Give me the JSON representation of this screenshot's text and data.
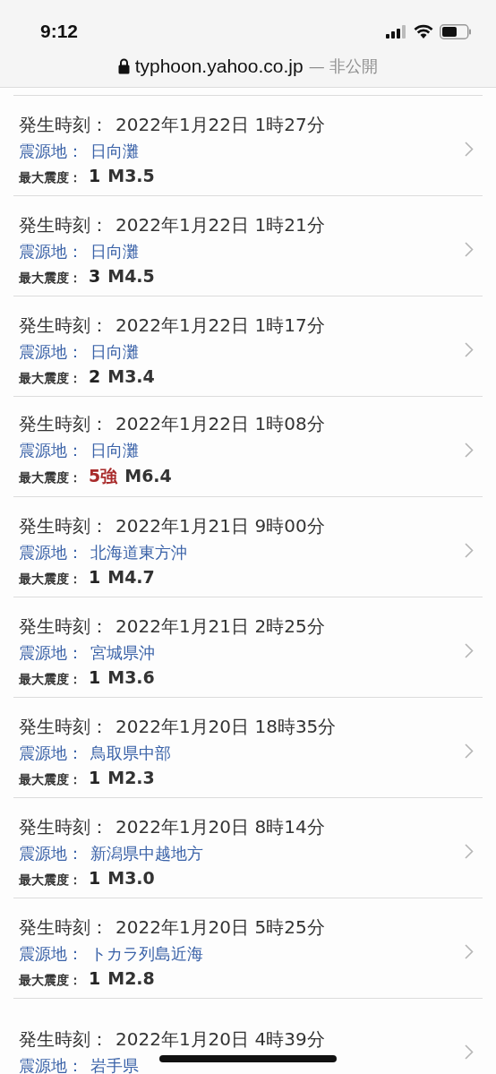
{
  "status_bar": {
    "time": "9:12"
  },
  "address_bar": {
    "domain": "typhoon.yahoo.co.jp",
    "suffix": "— 非公開"
  },
  "events": [
    {
      "time_label": "発生時刻：",
      "time": "2022年1月22日 1時27分",
      "epicenter_label": "震源地：",
      "epicenter": "日向灘",
      "intensity_label": "最大震度：",
      "intensity": "1",
      "color": "#222222",
      "magnitude": "M3.5"
    },
    {
      "time_label": "発生時刻：",
      "time": "2022年1月22日 1時21分",
      "epicenter_label": "震源地：",
      "epicenter": "日向灘",
      "intensity_label": "最大震度：",
      "intensity": "3",
      "color": "#222222",
      "magnitude": "M4.5"
    },
    {
      "time_label": "発生時刻：",
      "time": "2022年1月22日 1時17分",
      "epicenter_label": "震源地：",
      "epicenter": "日向灘",
      "intensity_label": "最大震度：",
      "intensity": "2",
      "color": "#222222",
      "magnitude": "M3.4"
    },
    {
      "time_label": "発生時刻：",
      "time": "2022年1月22日 1時08分",
      "epicenter_label": "震源地：",
      "epicenter": "日向灘",
      "intensity_label": "最大震度：",
      "intensity": "5強",
      "color": "#a82a2a",
      "magnitude": "M6.4"
    },
    {
      "time_label": "発生時刻：",
      "time": "2022年1月21日 9時00分",
      "epicenter_label": "震源地：",
      "epicenter": "北海道東方沖",
      "intensity_label": "最大震度：",
      "intensity": "1",
      "color": "#222222",
      "magnitude": "M4.7"
    },
    {
      "time_label": "発生時刻：",
      "time": "2022年1月21日 2時25分",
      "epicenter_label": "震源地：",
      "epicenter": "宮城県沖",
      "intensity_label": "最大震度：",
      "intensity": "1",
      "color": "#222222",
      "magnitude": "M3.6"
    },
    {
      "time_label": "発生時刻：",
      "time": "2022年1月20日 18時35分",
      "epicenter_label": "震源地：",
      "epicenter": "鳥取県中部",
      "intensity_label": "最大震度：",
      "intensity": "1",
      "color": "#222222",
      "magnitude": "M2.3"
    },
    {
      "time_label": "発生時刻：",
      "time": "2022年1月20日 8時14分",
      "epicenter_label": "震源地：",
      "epicenter": "新潟県中越地方",
      "intensity_label": "最大震度：",
      "intensity": "1",
      "color": "#222222",
      "magnitude": "M3.0"
    },
    {
      "time_label": "発生時刻：",
      "time": "2022年1月20日 5時25分",
      "epicenter_label": "震源地：",
      "epicenter": "トカラ列島近海",
      "intensity_label": "最大震度：",
      "intensity": "1",
      "color": "#222222",
      "magnitude": "M2.8"
    },
    {
      "time_label": "発生時刻：",
      "time": "2022年1月20日 4時39分",
      "epicenter_label": "震源地：",
      "epicenter": "岩手県"
    }
  ]
}
